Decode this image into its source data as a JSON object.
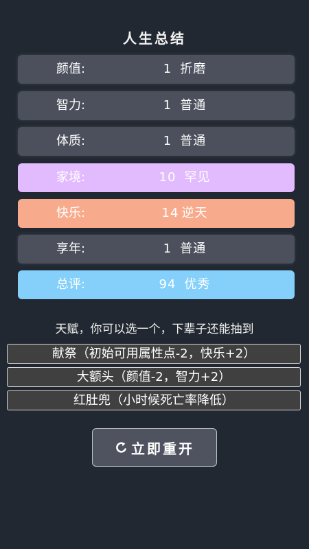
{
  "title": "人生总结",
  "colors": {
    "background": "#222831",
    "normal_row": "#4b505c",
    "rare_row": "#e2bbfe",
    "legendary_row": "#f7ab8c",
    "excellent_row": "#84d0fa"
  },
  "stats": [
    {
      "label": "颜值:",
      "value": "1",
      "grade": "折磨",
      "color": "#4b505c"
    },
    {
      "label": "智力:",
      "value": "1",
      "grade": "普通",
      "color": "#4b505c"
    },
    {
      "label": "体质:",
      "value": "1",
      "grade": "普通",
      "color": "#4b505c"
    },
    {
      "label": "家境:",
      "value": "10",
      "grade": "罕见",
      "color": "#e2bbfe"
    },
    {
      "label": "快乐:",
      "value": "14",
      "grade": "逆天",
      "color": "#f7ab8c"
    },
    {
      "label": "享年:",
      "value": "1",
      "grade": "普通",
      "color": "#4b505c"
    },
    {
      "label": "总评:",
      "value": "94",
      "grade": "优秀",
      "color": "#84d0fa"
    }
  ],
  "talents": {
    "caption": "天赋，你可以选一个，下辈子还能抽到",
    "items": [
      {
        "label": "献祭（初始可用属性点-2，快乐+2）"
      },
      {
        "label": "大额头（颜值-2，智力+2）"
      },
      {
        "label": "红肚兜（小时候死亡率降低）"
      }
    ]
  },
  "restart_button": {
    "label": "立即重开",
    "icon": "restart-icon"
  }
}
